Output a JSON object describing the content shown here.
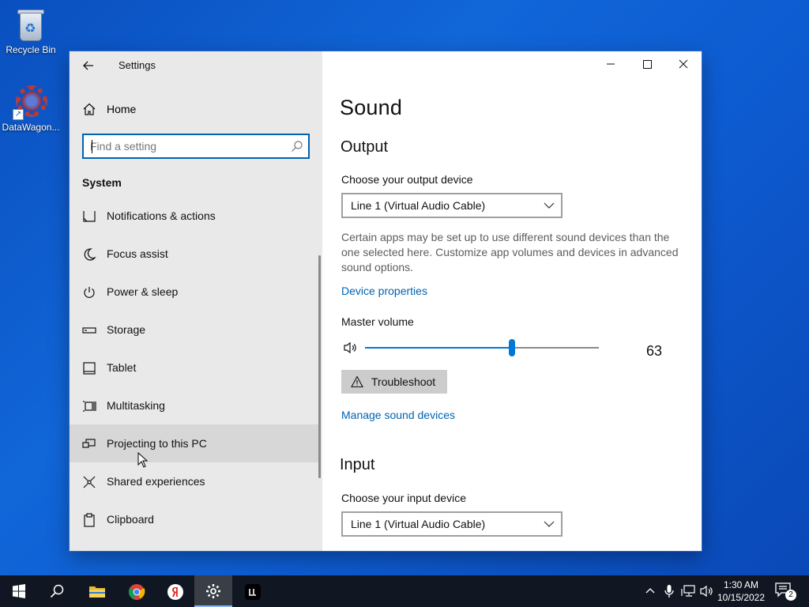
{
  "desktop": {
    "icons": [
      {
        "label": "Recycle Bin",
        "icon": "recycle-bin-icon"
      },
      {
        "label": "DataWagon...",
        "icon": "datawagon-app-icon"
      }
    ]
  },
  "window": {
    "app_title": "Settings",
    "sidebar": {
      "home_label": "Home",
      "search_placeholder": "Find a setting",
      "section_label": "System",
      "items": [
        {
          "label": "Notifications & actions",
          "icon": "notifications-icon"
        },
        {
          "label": "Focus assist",
          "icon": "moon-icon"
        },
        {
          "label": "Power & sleep",
          "icon": "power-icon"
        },
        {
          "label": "Storage",
          "icon": "storage-icon"
        },
        {
          "label": "Tablet",
          "icon": "tablet-icon"
        },
        {
          "label": "Multitasking",
          "icon": "multitasking-icon"
        },
        {
          "label": "Projecting to this PC",
          "icon": "projecting-icon"
        },
        {
          "label": "Shared experiences",
          "icon": "shared-experiences-icon"
        },
        {
          "label": "Clipboard",
          "icon": "clipboard-icon"
        }
      ],
      "hovered_item": "Projecting to this PC"
    },
    "content": {
      "page_title": "Sound",
      "output": {
        "heading": "Output",
        "device_label": "Choose your output device",
        "device_value": "Line 1 (Virtual Audio Cable)",
        "description": "Certain apps may be set up to use different sound devices than the one selected here. Customize app volumes and devices in advanced sound options.",
        "device_properties_link": "Device properties",
        "master_volume_label": "Master volume",
        "master_volume_value": 63,
        "troubleshoot_label": "Troubleshoot",
        "manage_devices_link": "Manage sound devices"
      },
      "input": {
        "heading": "Input",
        "device_label": "Choose your input device",
        "device_value": "Line 1 (Virtual Audio Cable)"
      }
    }
  },
  "taskbar": {
    "pinned": [
      "start-icon",
      "search-icon",
      "file-explorer-icon",
      "chrome-icon",
      "yandex-browser-icon",
      "settings-icon",
      "terminal-app-icon"
    ],
    "active": "settings-icon",
    "clock": {
      "time": "1:30 AM",
      "date": "10/15/2022"
    },
    "notification_count": "2"
  },
  "colors": {
    "accent": "#0078d7",
    "link": "#0063b1",
    "sidebar_bg": "#e9e9e9",
    "taskbar_bg": "#111722"
  }
}
